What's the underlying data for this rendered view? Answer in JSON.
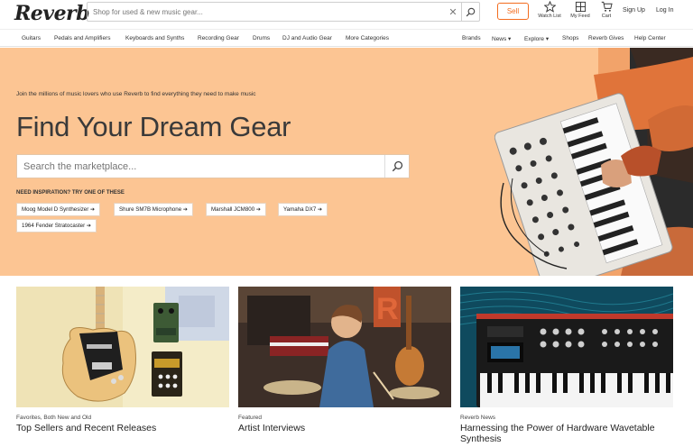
{
  "header": {
    "logo": "Reverb",
    "search_placeholder": "Shop for used & new music gear...",
    "clear_glyph": "✕",
    "sell_label": "Sell",
    "watch_list": "Watch List",
    "my_feed": "My Feed",
    "cart": "Cart",
    "sign_up": "Sign Up",
    "log_in": "Log In",
    "icons": [
      "star-icon",
      "feed-grid-icon",
      "cart-icon",
      "search-icon"
    ]
  },
  "nav": {
    "categories": [
      "Guitars",
      "Pedals and Amplifiers",
      "Keyboards and Synths",
      "Recording Gear",
      "Drums",
      "DJ and Audio Gear",
      "More Categories"
    ],
    "right": [
      "Brands",
      "News ▾",
      "Explore ▾",
      "Shops",
      "Reverb Gives",
      "Help Center"
    ]
  },
  "hero": {
    "tagline": "Join the millions of music lovers who use Reverb to find everything they need to make music",
    "title": "Find Your Dream Gear",
    "search_placeholder": "Search the marketplace...",
    "inspiration_label": "NEED INSPIRATION? TRY ONE OF THESE",
    "chips": [
      "Moog Model D Synthesizer ➔",
      "Shure SM7B Microphone ➔",
      "Marshall JCM800 ➔",
      "Yamaha DX7 ➔",
      "1964 Fender Stratocaster ➔"
    ],
    "background_color": "#fcc593"
  },
  "cards": [
    {
      "kicker": "Favorites, Both New and Old",
      "title": "Top Sellers and Recent Releases"
    },
    {
      "kicker": "Featured",
      "title": "Artist Interviews"
    },
    {
      "kicker": "Reverb News",
      "title": "Harnessing the Power of Hardware Wavetable Synthesis"
    }
  ],
  "colors": {
    "accent": "#f36c1f",
    "text": "#222222"
  }
}
